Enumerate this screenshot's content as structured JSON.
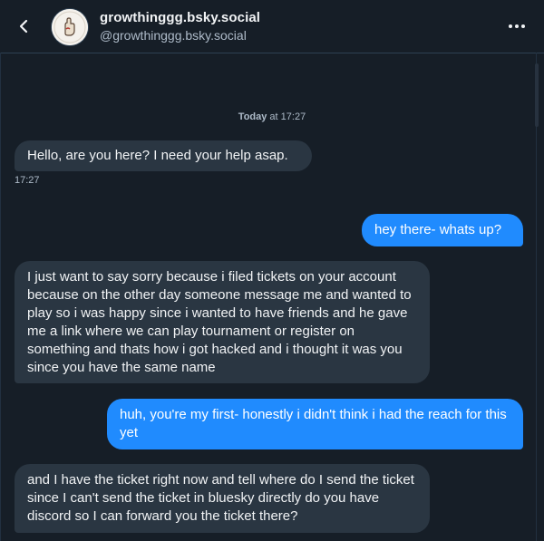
{
  "header": {
    "display_name": "growthinggg.bsky.social",
    "handle": "@growthinggg.bsky.social",
    "back_icon": "chevron-left-icon",
    "more_icon": "more-horizontal-icon"
  },
  "conversation": {
    "day_label_bold": "Today",
    "day_label_rest": " at 17:27",
    "messages": [
      {
        "from": "them",
        "text": "Hello, are you here? I need your help asap.",
        "time": "17:27"
      },
      {
        "from": "me",
        "text": "hey there- whats up?"
      },
      {
        "from": "them",
        "text": "I just want to say sorry because i filed tickets on your account because on the other day someone message me and wanted to play so i was happy since i wanted to have friends and he gave me a link where we can play tournament or register on something and thats how i got hacked and i thought it was you since you have the same name"
      },
      {
        "from": "me",
        "text": "huh, you're my first- honestly i didn't think i had the reach for this yet"
      },
      {
        "from": "them",
        "text": "and I have the ticket right now and tell where do I send the ticket since I can't send the ticket in bluesky directly do you have discord so I can forward you the ticket there?"
      }
    ]
  },
  "colors": {
    "background": "#161e27",
    "incoming_bubble": "#2a3642",
    "outgoing_bubble": "#208bfe"
  }
}
